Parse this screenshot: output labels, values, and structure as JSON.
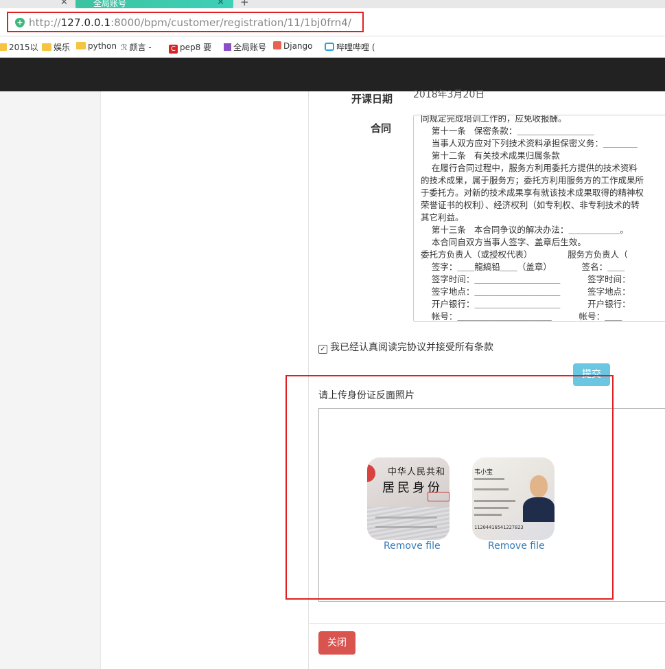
{
  "browser": {
    "active_tab_title": "全局账号",
    "new_tab_label": "+",
    "close_glyph": "✕",
    "url_scheme": "http://",
    "url_host": "127.0.0.1",
    "url_rest": ":8000/bpm/customer/registration/11/1bj0frn4/",
    "bookmarks": [
      {
        "label": "2015以",
        "icon": "folder-icon"
      },
      {
        "label": "娱乐",
        "icon": "folder-icon"
      },
      {
        "label": "python",
        "icon": "folder-icon"
      },
      {
        "label": "颜言 -",
        "icon": "site-icon"
      },
      {
        "label": "pep8 要",
        "icon": "csdn-icon"
      },
      {
        "label": "全局账号",
        "icon": "edit-icon"
      },
      {
        "label": "Django",
        "icon": "jianshu-icon"
      },
      {
        "label": "哔哩哔哩 (",
        "icon": "bilibili-icon"
      }
    ]
  },
  "form": {
    "start_date_label": "开课日期",
    "start_date_value": "2018年3月20日",
    "contract_label": "合同",
    "contract_lines": [
      "同规定完成培训工作的，应免收报酬。",
      "    第十一条   保密条款：＿＿＿＿＿＿＿＿＿",
      "    当事人双方应对下列技术资料承担保密义务：＿＿＿＿",
      "    第十二条   有关技术成果归属条款",
      "    在履行合同过程中，服务方利用委托方提供的技术资料",
      "的技术成果，属于服务方；委托方利用服务方的工作成果所",
      "于委托方。对新的技术成果享有就该技术成果取得的精神权",
      "荣誉证书的权利）、经济权利（如专利权、非专利技术的转",
      "其它利益。",
      "    第十三条   本合同争议的解决办法：＿＿＿＿＿＿。",
      "    本合同自双方当事人签字、盖章后生效。",
      "委托方负责人（或授权代表）             服务方负责人（",
      "    签字：＿＿龍縞铅＿＿（盖章）           签名：＿＿",
      "    签字时间：＿＿＿＿＿＿＿＿＿＿          签字时间：",
      "    签字地点：＿＿＿＿＿＿＿＿＿＿          签字地点：",
      "    开户银行：＿＿＿＿＿＿＿＿＿＿          开户银行：",
      "    帐号：＿＿＿＿＿＿＿＿＿＿＿          帐号：＿＿"
    ],
    "agree_checked": true,
    "agree_text": "我已经认真阅读完协议并接受所有条款",
    "submit_label": "提交",
    "upload_label": "请上传身份证反面照片",
    "files": [
      {
        "remove_label": "Remove file",
        "card_title": "中华人民共和",
        "card_subtitle": "居民身份"
      },
      {
        "remove_label": "Remove file",
        "name": "韦小宝",
        "number": "11204416541227823"
      }
    ],
    "close_label": "关闭"
  },
  "colors": {
    "highlight": "#e02020",
    "navbar": "#222222",
    "submit": "#5bc0de",
    "close": "#d9534f",
    "link": "#337ab7"
  }
}
